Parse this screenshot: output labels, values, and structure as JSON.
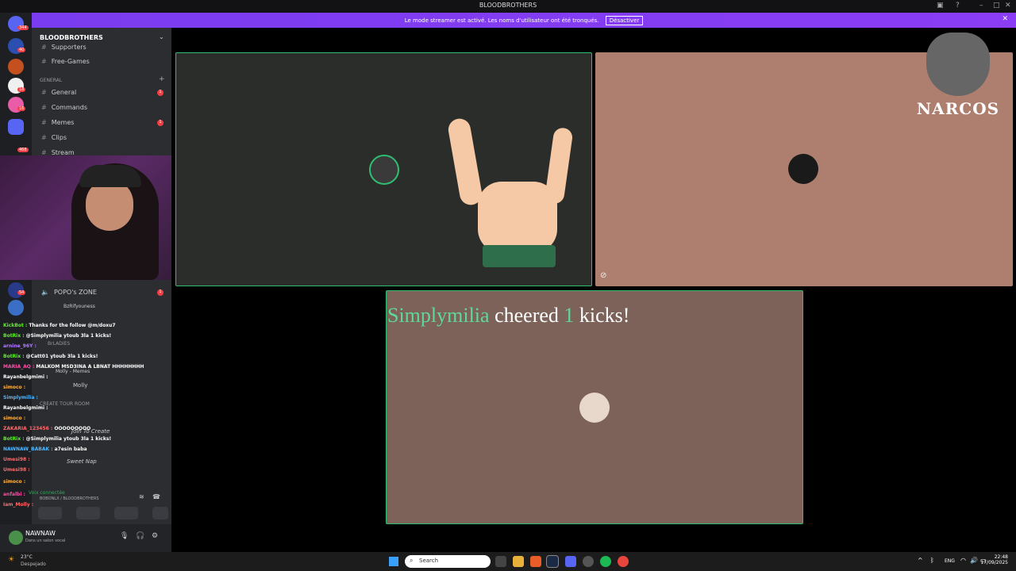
{
  "window": {
    "title": "BLOODBROTHERS"
  },
  "banner": {
    "message": "Le mode streamer est activé. Les noms d'utilisateur ont été tronqués.",
    "button": "Désactiver"
  },
  "rail": {
    "badges": [
      "344",
      "40",
      "18",
      "16",
      "468",
      "54"
    ]
  },
  "sidebar": {
    "server_name": "BLOODBROTHERS",
    "top_channels": [
      {
        "name": "Supporters"
      },
      {
        "name": "Free-Games"
      }
    ],
    "category_general": "GENERAL",
    "channels": [
      {
        "name": "General",
        "badge": "1"
      },
      {
        "name": "Commands"
      },
      {
        "name": "Memes",
        "badge": "1"
      },
      {
        "name": "Clips"
      },
      {
        "name": "Stream"
      }
    ],
    "voice": {
      "zone": "POPO's ZONE",
      "zone_badge": "1",
      "user": "BzRifyouness",
      "ladies": "BrLADIES",
      "molly_memes": "Molly - Memes",
      "molly": "Molly",
      "create_tour": "CREATE TOUR ROOM",
      "join_create": "Join To Create",
      "sweet_nap": "Sweet Nap",
      "voice_connected": "Voix connectée",
      "voice_path": "BOBONLX / BLOODBROTHERS"
    }
  },
  "chat": [
    {
      "user": "KickBot :",
      "msg": "Thanks for the follow @m/doxu7",
      "color": "#53fc18"
    },
    {
      "user": "BotRix :",
      "msg": "@Simplymilia ytoub 3la 1 kicks!",
      "color": "#53fc18"
    },
    {
      "user": "arnine_96Y :",
      "msg": "",
      "color": "#b57cff"
    },
    {
      "user": "BotRix :",
      "msg": "@Catt01 ytoub 3la 1 kicks!",
      "color": "#53fc18"
    },
    {
      "user": "MARIA_AQ :",
      "msg": "MALKOM MSD3INA A LBNAT HHHHHHHH",
      "color": "#ff4fa8"
    },
    {
      "user": "Rayanbelgmimi :",
      "msg": "",
      "color": "#ffffff"
    },
    {
      "user": "simoco :",
      "msg": "",
      "color": "#ffb347"
    },
    {
      "user": "Simplymilia :",
      "msg": "",
      "color": "#4fb8ff"
    },
    {
      "user": "Rayanbelgmimi :",
      "msg": "",
      "color": "#ffffff"
    },
    {
      "user": "simoco :",
      "msg": "",
      "color": "#ffb347"
    },
    {
      "user": "ZAKARIA_123456 :",
      "msg": "OOOOOOOOO",
      "color": "#ff6b6b"
    },
    {
      "user": "BotRix :",
      "msg": "@Simplymilia ytoub 3la 1 kicks!",
      "color": "#53fc18"
    },
    {
      "user": "NAWNAW_BABAK :",
      "msg": "a7esin baba",
      "color": "#4fb8ff"
    },
    {
      "user": "Umesi98 :",
      "msg": "",
      "color": "#ff6b6b"
    },
    {
      "user": "Umesi98 :",
      "msg": "",
      "color": "#ff6b6b"
    },
    {
      "user": "simoco :",
      "msg": "",
      "color": "#ffb347"
    },
    {
      "user": "anfalbi :",
      "msg": "",
      "color": "#ff4fa8"
    },
    {
      "user": "Iam_Molly :",
      "msg": "",
      "color": "#ff6b6b"
    }
  ],
  "user": {
    "name": "NAWNAW",
    "status": "Dans un salon vocal"
  },
  "stage": {
    "cheer_name": "Simplymilia",
    "cheer_verb": "cheered",
    "cheer_count": "1",
    "cheer_unit": "kicks!",
    "logo_text": "NARCOS"
  },
  "taskbar": {
    "weather_temp": "23°C",
    "weather_desc": "Despejado",
    "search_placeholder": "Search",
    "lang": "ENG",
    "time": "22:48",
    "date": "17/09/2025"
  },
  "colors": {
    "accent": "#2fbf71",
    "banner": "#8a3df5",
    "cheer_green": "#5fd89a"
  }
}
